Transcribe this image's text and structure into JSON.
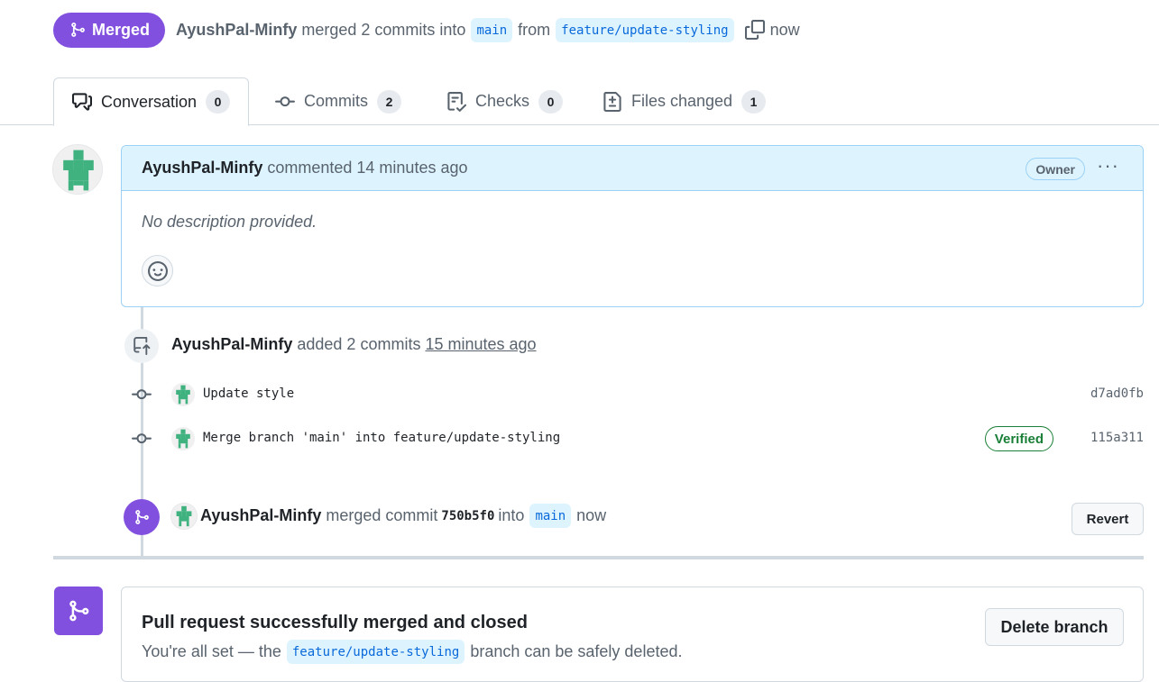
{
  "header": {
    "status_badge": "Merged",
    "author": "AyushPal-Minfy",
    "action_text": "merged 2 commits into",
    "base_branch": "main",
    "from_text": "from",
    "head_branch": "feature/update-styling",
    "time": "now"
  },
  "tabs": [
    {
      "label": "Conversation",
      "count": "0",
      "icon": "comment-discussion-icon"
    },
    {
      "label": "Commits",
      "count": "2",
      "icon": "git-commit-icon"
    },
    {
      "label": "Checks",
      "count": "0",
      "icon": "checklist-icon"
    },
    {
      "label": "Files changed",
      "count": "1",
      "icon": "file-diff-icon"
    }
  ],
  "comment": {
    "author": "AyushPal-Minfy",
    "action": "commented",
    "time": "14 minutes ago",
    "role_badge": "Owner",
    "menu": "···",
    "body": "No description provided."
  },
  "commits_event": {
    "author": "AyushPal-Minfy",
    "action": "added 2 commits",
    "time": "15 minutes ago",
    "commits": [
      {
        "message": "Update style",
        "sha": "d7ad0fb",
        "verified": ""
      },
      {
        "message": "Merge branch 'main' into feature/update-styling",
        "sha": "115a311",
        "verified": "Verified"
      }
    ]
  },
  "merge_event": {
    "author": "AyushPal-Minfy",
    "action": "merged commit",
    "sha": "750b5f0",
    "into_text": "into",
    "branch": "main",
    "time": "now",
    "revert_label": "Revert"
  },
  "merge_status": {
    "title": "Pull request successfully merged and closed",
    "desc_before": "You're all set — the",
    "branch": "feature/update-styling",
    "desc_after": "branch can be safely deleted.",
    "delete_label": "Delete branch"
  },
  "colors": {
    "merged_purple": "#8250df",
    "branch_bg": "#ddf4ff",
    "branch_fg": "#0969da",
    "verified_green": "#1a7f37",
    "identicon_green": "#3fb27f"
  }
}
